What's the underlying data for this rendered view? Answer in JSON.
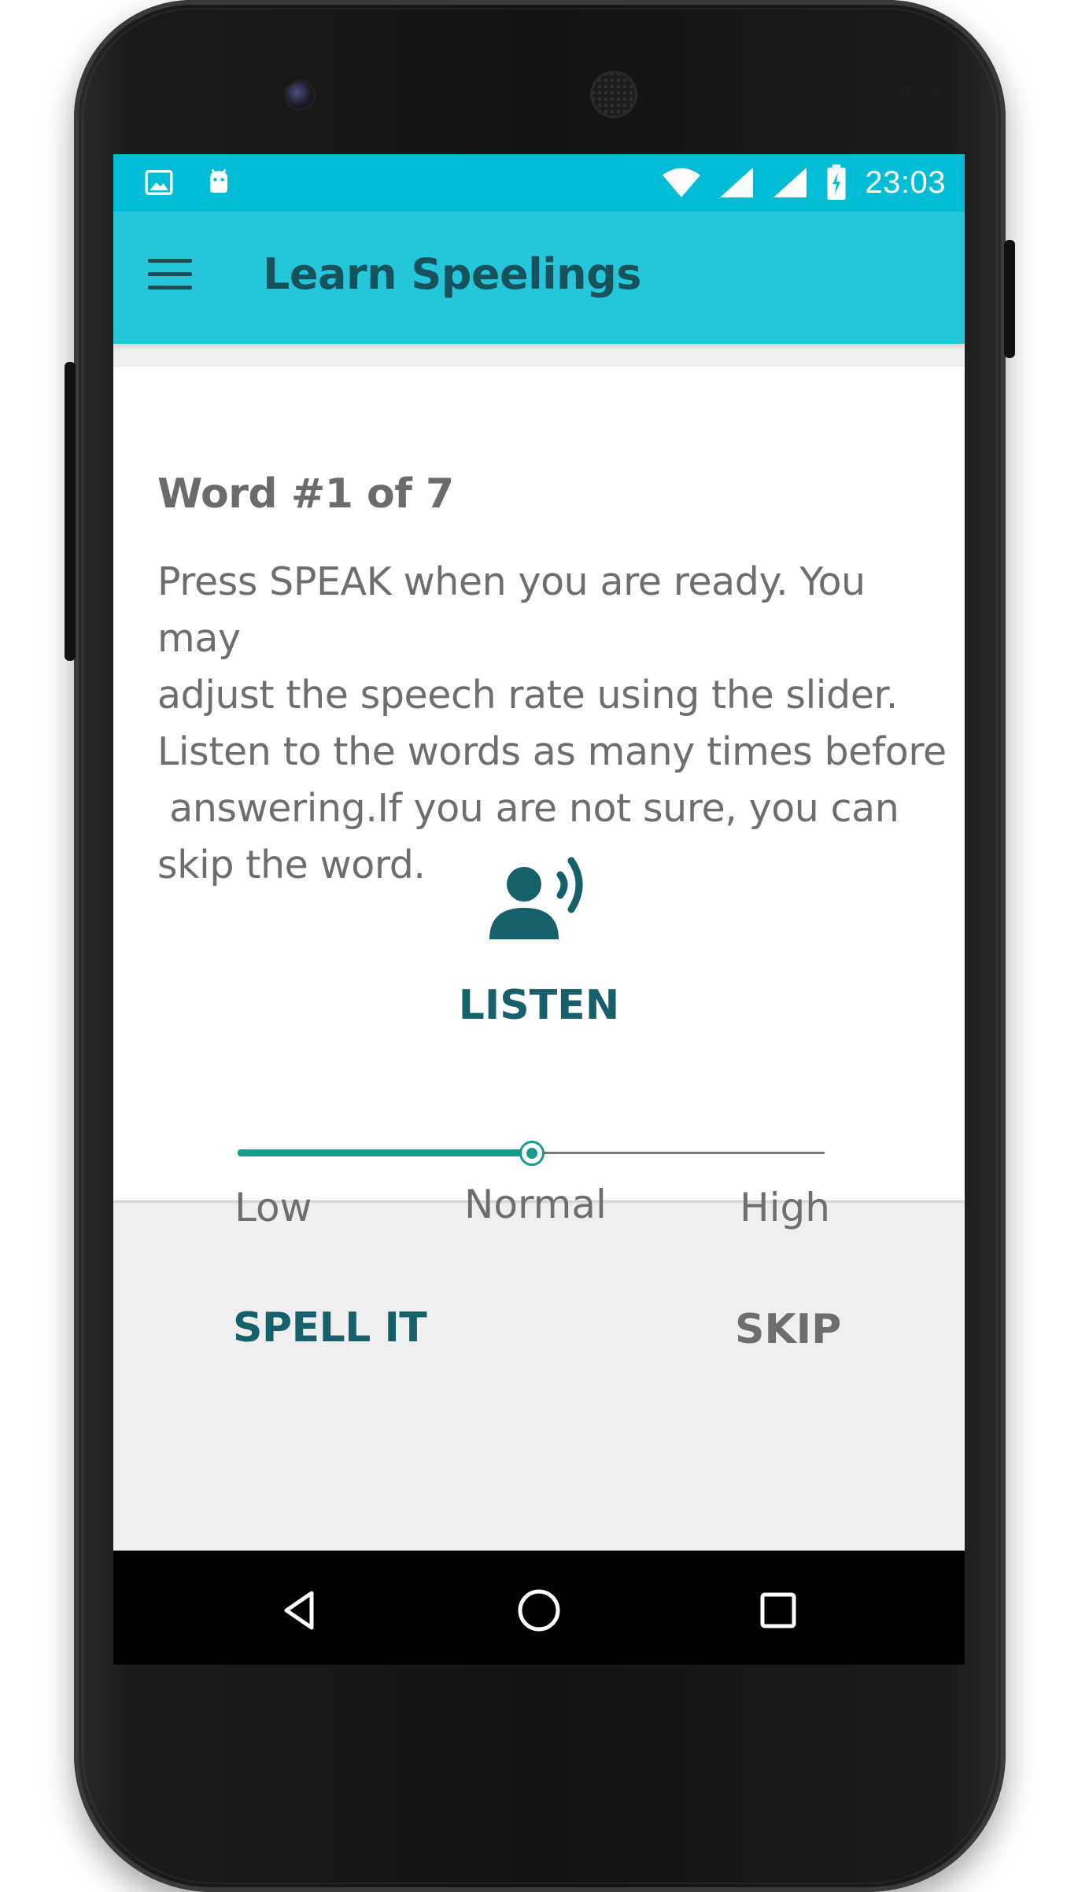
{
  "status_bar": {
    "time": "23:03",
    "left_icons": [
      "image-icon",
      "android-icon"
    ],
    "right_icons": [
      "wifi-icon",
      "signal-icon",
      "signal-icon",
      "battery-charging-icon"
    ]
  },
  "app_bar": {
    "title": "Learn Speelings",
    "menu_icon": "hamburger-menu-icon"
  },
  "card": {
    "word_counter": "Word #1 of 7",
    "instructions": "Press SPEAK when you are ready. You may\nadjust the speech rate using the slider.\nListen to the words as many times before\n answering.If you are not sure, you can\nskip the word.",
    "listen": {
      "icon": "record-voice-icon",
      "label": "LISTEN"
    },
    "speech_rate": {
      "value": 0.5,
      "labels": {
        "low": "Low",
        "normal": "Normal",
        "high": "High"
      }
    },
    "actions": {
      "spell_label": "SPELL IT",
      "skip_label": "SKIP"
    }
  },
  "nav_bar": {
    "icons": [
      "back-icon",
      "home-icon",
      "recent-apps-icon"
    ]
  },
  "colors": {
    "status_bar": "#00bcd4",
    "app_bar": "#26c6da",
    "accent_dark": "#15606b",
    "slider": "#1a9a8a",
    "text_gray": "#6e6e6e"
  }
}
